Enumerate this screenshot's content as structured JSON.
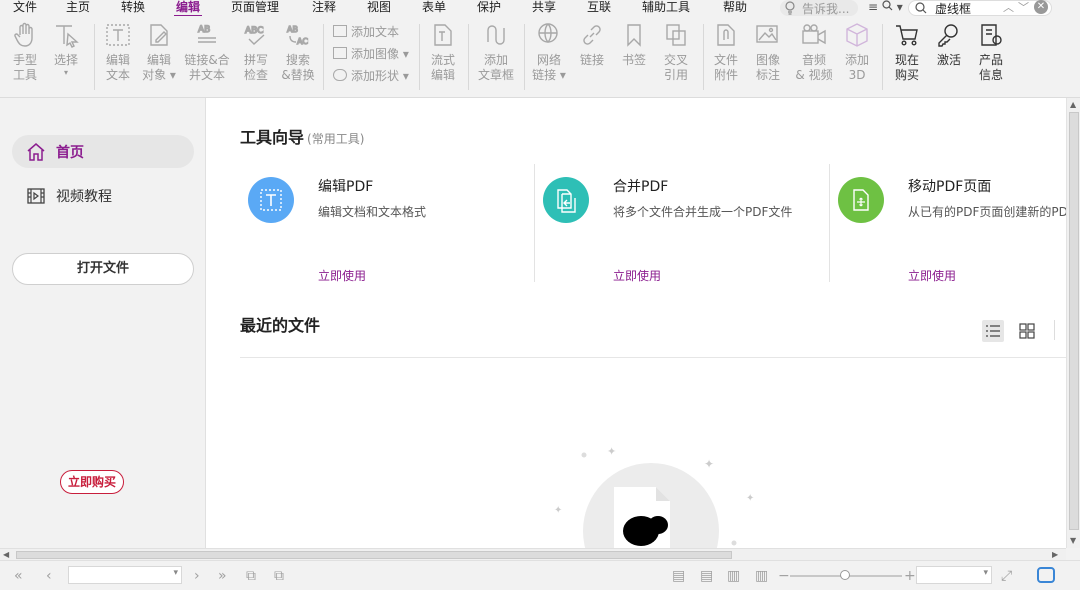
{
  "menu": {
    "items": [
      "文件",
      "主页",
      "转换",
      "编辑",
      "页面管理",
      "注释",
      "视图",
      "表单",
      "保护",
      "共享",
      "互联",
      "辅助工具",
      "帮助"
    ],
    "active": "编辑",
    "tell_me_placeholder": "告诉我...",
    "search_value": "虚线框"
  },
  "ribbon": {
    "hand_tool": [
      "手型",
      "工具"
    ],
    "select": [
      "选择"
    ],
    "edit_text": [
      "编辑",
      "文本"
    ],
    "edit_object": [
      "编辑",
      "对象"
    ],
    "link_merge": [
      "链接&合",
      "并文本"
    ],
    "spell_check": [
      "拼写",
      "检查"
    ],
    "search_replace": [
      "搜索",
      "&替换"
    ],
    "add_text": "添加文本",
    "add_image": "添加图像",
    "add_shape": "添加形状",
    "flow_edit": [
      "流式",
      "编辑"
    ],
    "add_article": [
      "添加",
      "文章框"
    ],
    "web_link": [
      "网络",
      "链接"
    ],
    "link": [
      "链接"
    ],
    "bookmark": [
      "书签"
    ],
    "cross_ref": [
      "交叉",
      "引用"
    ],
    "file_attach": [
      "文件",
      "附件"
    ],
    "image_annot": [
      "图像",
      "标注"
    ],
    "audio_video": [
      "音频",
      "& 视频"
    ],
    "add_3d": [
      "添加",
      "3D"
    ],
    "buy_now": [
      "现在",
      "购买"
    ],
    "activate": [
      "激活"
    ],
    "product_info": [
      "产品",
      "信息"
    ]
  },
  "sidebar": {
    "home": "首页",
    "video_tutorial": "视频教程",
    "open_file": "打开文件",
    "buy_now": "立即购买"
  },
  "main": {
    "tools_title": "工具向导",
    "tools_subtitle": "(常用工具)",
    "cards": [
      {
        "title": "编辑PDF",
        "desc": "编辑文档和文本格式",
        "link": "立即使用",
        "color": "#5aa9f5"
      },
      {
        "title": "合并PDF",
        "desc": "将多个文件合并生成一个PDF文件",
        "link": "立即使用",
        "color": "#2ebfb6"
      },
      {
        "title": "移动PDF页面",
        "desc": "从已有的PDF页面创建新的PD",
        "link": "立即使用",
        "color": "#6ec143"
      }
    ],
    "recent_title": "最近的文件"
  },
  "colors": {
    "accent": "#8b1d8f",
    "buy_red": "#c81e3c"
  },
  "icons": [
    "hand-icon",
    "select-icon",
    "edit-text-icon",
    "edit-object-icon",
    "home-icon",
    "video-icon",
    "cart-icon",
    "key-icon",
    "product-info-icon"
  ]
}
